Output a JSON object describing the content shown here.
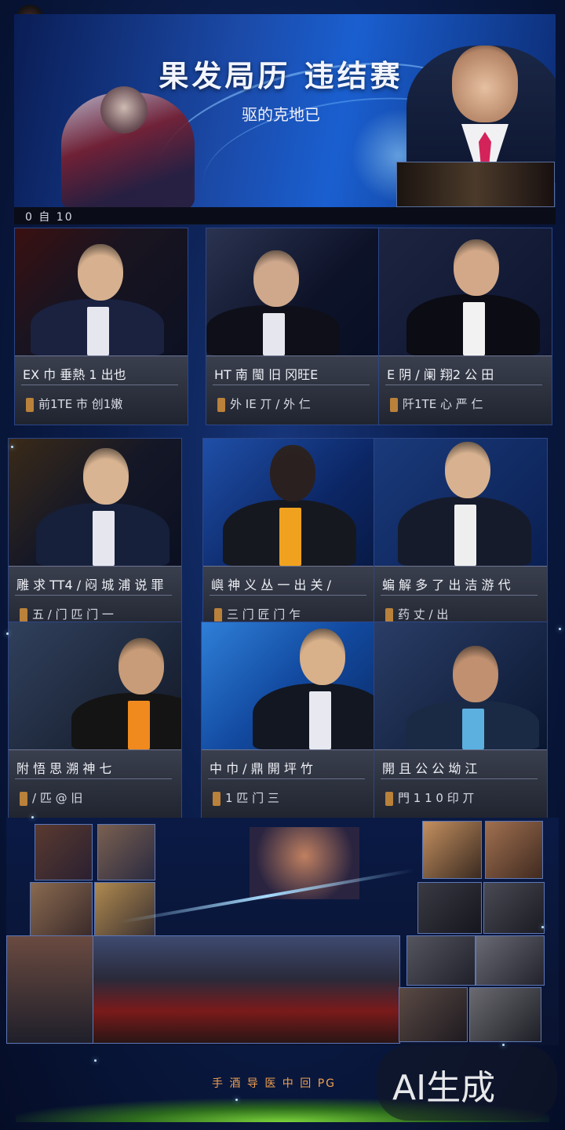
{
  "banner": {
    "title": "果发局历 违结赛",
    "subtitle": "驱的克地已",
    "strip_label": "0 自 10"
  },
  "cards": [
    {
      "title": "EX 巾 垂熱 1 出也",
      "meta": "前1TE 市 创1嫩"
    },
    {
      "title": "HT 南 閩 旧 冈旺E",
      "meta": "外 IE 丌 / 外 仁"
    },
    {
      "title": "E 阴 / 阑 翔2 公 田",
      "meta": "阡1TE 心 严 仁"
    },
    {
      "title": "雕 求 TT4 / 闷 城 浦 说 罪",
      "meta": "五 / 门 匹 门 一"
    },
    {
      "title": "嶼 神 义 丛 一 出 关 /",
      "meta": "三 门 匠 门 乍"
    },
    {
      "title": "蝙 解 多 了 出 洁 游 代",
      "meta": "药 丈 / 出"
    },
    {
      "title": "附 悟 思 溯 神 七",
      "meta": "/ 匹 @ 旧"
    },
    {
      "title": "中 巾 / 鼎 開 坪 竹",
      "meta": "1 匹 门 三"
    },
    {
      "title": "開 且 公 公 坳 江",
      "meta": "門 1 1 0 印 丌"
    }
  ],
  "footer": {
    "text": "手 酒 导 医 中 回 PG",
    "ai_label": "AI生成"
  }
}
